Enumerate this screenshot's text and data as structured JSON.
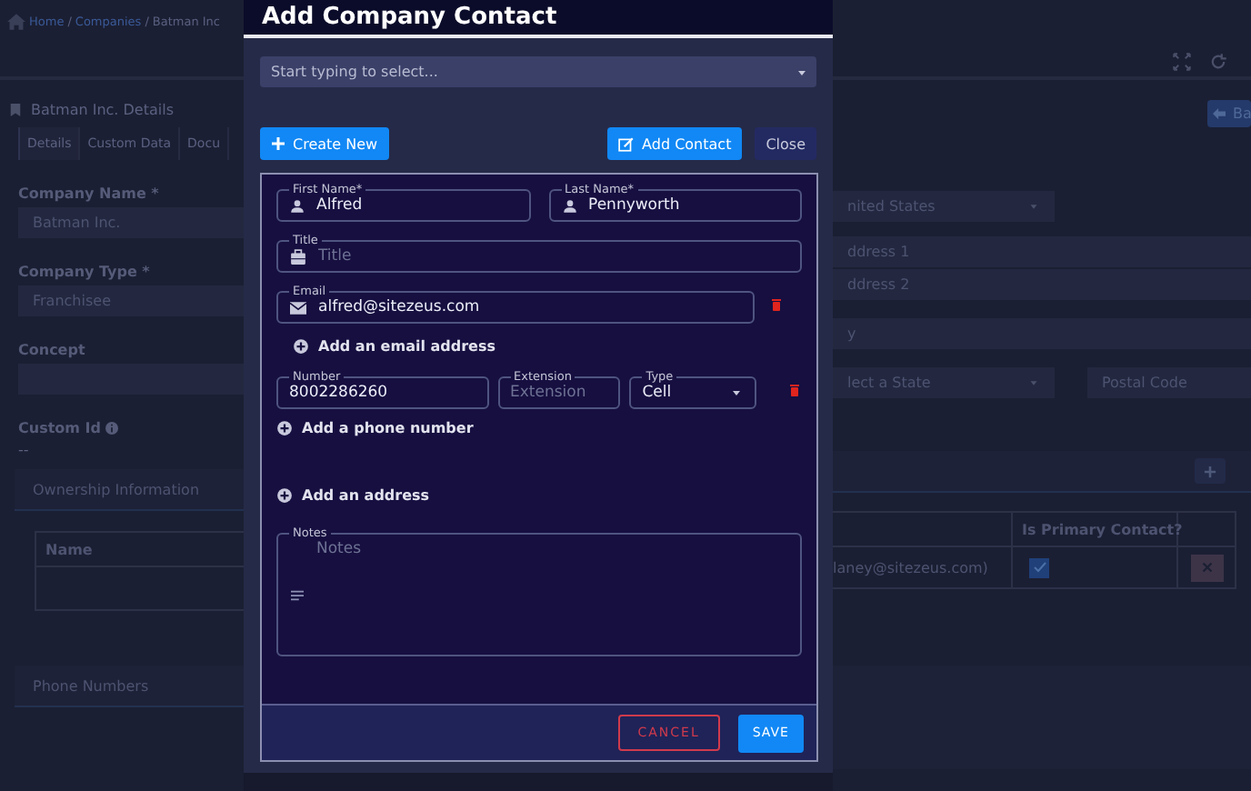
{
  "breadcrumb": [
    {
      "kind": "link",
      "text": "Home"
    },
    {
      "kind": "separator",
      "text": "/"
    },
    {
      "kind": "link",
      "text": "Companies"
    },
    {
      "kind": "separator",
      "text": "/"
    },
    {
      "kind": "current",
      "text": "Batman Inc"
    }
  ],
  "details_panel": {
    "title": "Batman Inc. Details",
    "tabs": [
      {
        "label": "Details",
        "selected": true
      },
      {
        "label": "Custom Data",
        "selected": false
      },
      {
        "label": "Docu",
        "selected": false
      }
    ],
    "fields": [
      {
        "label": "Company Name *",
        "value": "Batman Inc."
      },
      {
        "label": "Company Type *",
        "value": "Franchisee"
      },
      {
        "label": "Concept"
      }
    ],
    "custom_id": {
      "label": "Custom Id",
      "value": "--"
    },
    "back_button": "Ba",
    "address": {
      "country": "nited States",
      "address_1": "ddress 1",
      "address_2": "ddress 2",
      "city": "y",
      "state": "lect a State",
      "postal_code": "Postal Code"
    },
    "ownership": {
      "title": "Ownership Information",
      "columns": [
        "Name",
        "Is Primary Contact?"
      ],
      "rows": [
        {
          "name": "laney@sitezeus.com)",
          "is_primary": true
        }
      ]
    },
    "phone_section": {
      "title": "Phone Numbers"
    }
  },
  "modal": {
    "title": "Add Company Contact",
    "contact_select": {
      "placeholder": "Start typing to select..."
    },
    "create_new": "Create New",
    "add_contact": "Add Contact",
    "close": "Close",
    "form": {
      "first_name": {
        "label": "First Name*",
        "value": "Alfred"
      },
      "last_name": {
        "label": "Last Name*",
        "value": "Pennyworth"
      },
      "title_field": {
        "label": "Title",
        "placeholder": "Title"
      },
      "emails": [
        {
          "label": "Email",
          "value": "alfred@sitezeus.com"
        }
      ],
      "add_email": "Add an email address",
      "phones": [
        {
          "number": {
            "label": "Number",
            "value": "8002286260"
          },
          "extension": {
            "label": "Extension",
            "placeholder": "Extension"
          },
          "type": {
            "label": "Type",
            "value": "Cell"
          }
        }
      ],
      "add_phone": "Add a phone number",
      "add_address": "Add an address",
      "notes": {
        "label": "Notes",
        "placeholder": "Notes"
      }
    },
    "footer": {
      "cancel": "CANCEL",
      "save": "SAVE"
    }
  }
}
